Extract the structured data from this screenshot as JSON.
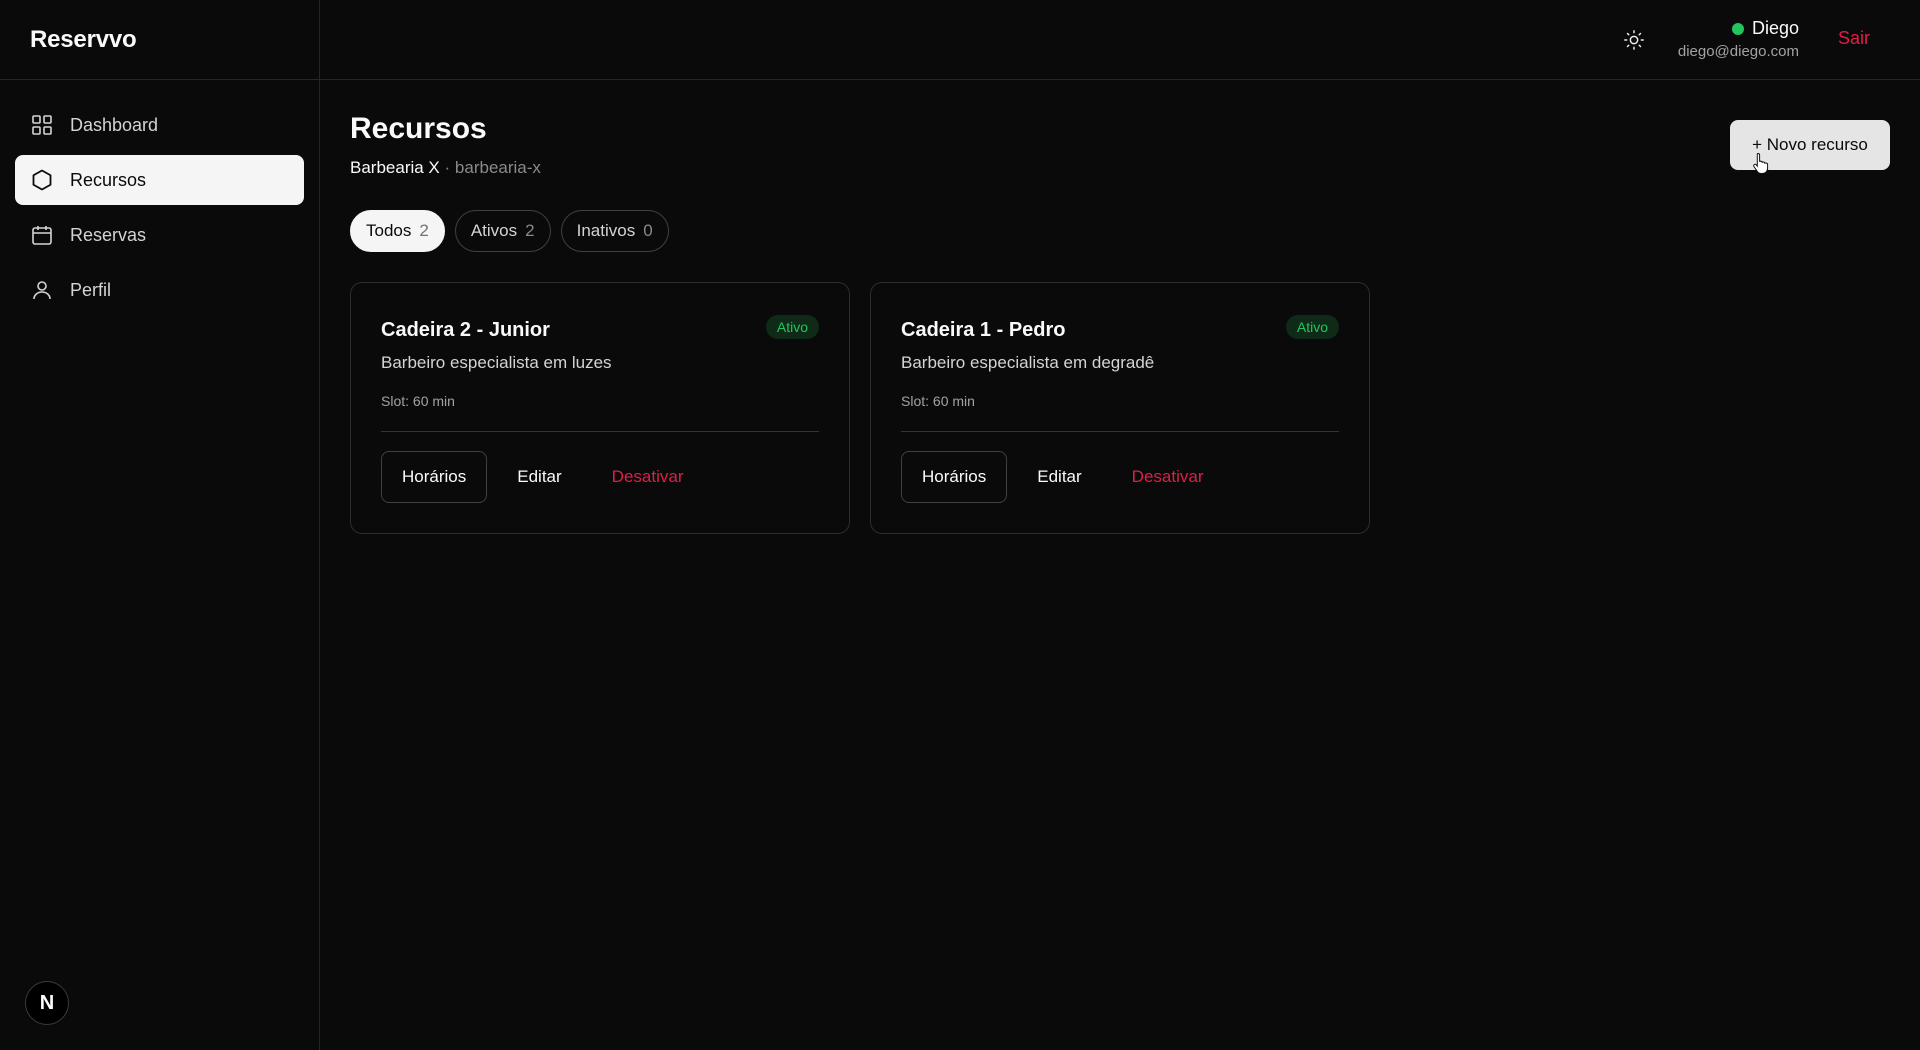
{
  "brand": "Reservvo",
  "sidebar": {
    "items": [
      {
        "label": "Dashboard",
        "icon": "grid-icon",
        "active": false
      },
      {
        "label": "Recursos",
        "icon": "hexagon-icon",
        "active": true
      },
      {
        "label": "Reservas",
        "icon": "calendar-icon",
        "active": false
      },
      {
        "label": "Perfil",
        "icon": "user-icon",
        "active": false
      }
    ],
    "footer_badge": "N"
  },
  "header": {
    "theme_icon": "sun-icon",
    "user_name": "Diego",
    "user_email": "diego@diego.com",
    "status_color": "#22c55e",
    "logout_label": "Sair"
  },
  "main": {
    "title": "Recursos",
    "business_name": "Barbearia X",
    "separator": "·",
    "business_slug": "barbearia-x",
    "new_button_label": "+ Novo recurso",
    "filters": [
      {
        "label": "Todos",
        "count": "2",
        "active": true
      },
      {
        "label": "Ativos",
        "count": "2",
        "active": false
      },
      {
        "label": "Inativos",
        "count": "0",
        "active": false
      }
    ],
    "cards": [
      {
        "title": "Cadeira 2 - Junior",
        "status": "Ativo",
        "description": "Barbeiro especialista em luzes",
        "slot": "Slot: 60 min",
        "actions": {
          "schedule": "Horários",
          "edit": "Editar",
          "deactivate": "Desativar"
        }
      },
      {
        "title": "Cadeira 1 - Pedro",
        "status": "Ativo",
        "description": "Barbeiro especialista em degradê",
        "slot": "Slot: 60 min",
        "actions": {
          "schedule": "Horários",
          "edit": "Editar",
          "deactivate": "Desativar"
        }
      }
    ]
  },
  "colors": {
    "background": "#0a0a0a",
    "accent_danger": "#e11d48",
    "accent_success": "#22c55e"
  }
}
